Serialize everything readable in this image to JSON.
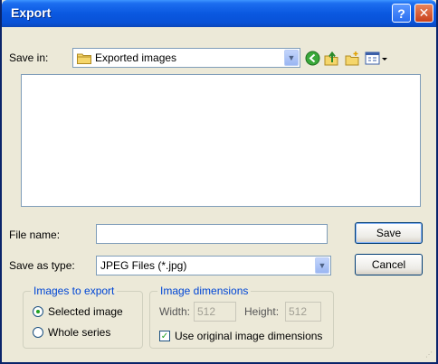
{
  "window": {
    "title": "Export",
    "help_glyph": "?",
    "close_glyph": "✕"
  },
  "toolbar": {
    "save_in_label": "Save in:",
    "folder": "Exported images",
    "icons": [
      "back-icon",
      "up-folder-icon",
      "new-folder-icon",
      "views-menu-icon"
    ]
  },
  "file_name": {
    "label": "File name:",
    "value": ""
  },
  "save_as_type": {
    "label": "Save as type:",
    "value": "JPEG Files (*.jpg)"
  },
  "buttons": {
    "save": "Save",
    "cancel": "Cancel"
  },
  "images_to_export": {
    "title": "Images to export",
    "options": [
      "Selected image",
      "Whole series"
    ],
    "selected_index": 0
  },
  "image_dimensions": {
    "title": "Image dimensions",
    "width_label": "Width:",
    "width_value": "512",
    "height_label": "Height:",
    "height_value": "512",
    "use_original_label": "Use original image dimensions",
    "use_original_checked": true
  },
  "colors": {
    "titlebar": "#0a58e0",
    "dialog_bg": "#ece9d8",
    "group_title": "#0046d5",
    "close_button": "#c9401a"
  }
}
